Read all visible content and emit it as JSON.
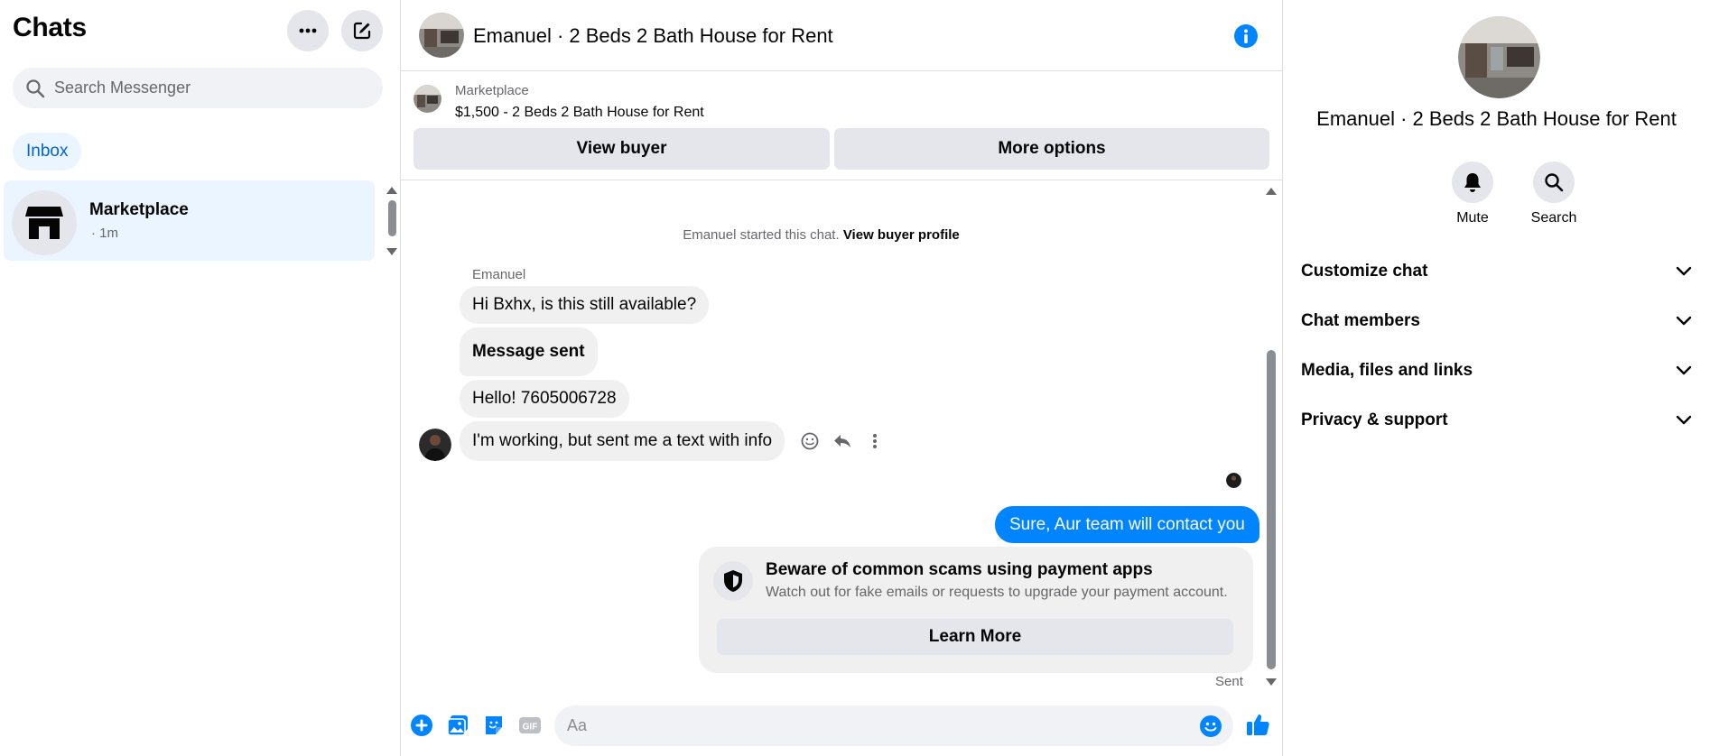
{
  "sidebar": {
    "title": "Chats",
    "search_placeholder": "Search Messenger",
    "filter_label": "Inbox",
    "conversation": {
      "name": "Marketplace",
      "time": "· 1m"
    }
  },
  "chat": {
    "header_title": "Emanuel · 2 Beds 2 Bath House for Rent",
    "listing": {
      "source": "Marketplace",
      "price_title": "$1,500 - 2 Beds 2 Bath House for Rent",
      "view_buyer_label": "View buyer",
      "more_options_label": "More options"
    },
    "started_text": "Emanuel started this chat.",
    "started_link": "View buyer profile",
    "sender_name": "Emanuel",
    "messages_in": [
      "Hi Bxhx, is this still available?",
      "Message sent",
      "Hello! 7605006728",
      "I'm working, but sent me a text with info"
    ],
    "message_out": "Sure, Aur team will contact you",
    "scam_notice": {
      "title": "Beware of common scams using payment apps",
      "description": "Watch out for fake emails or requests to upgrade your payment account.",
      "button_label": "Learn More"
    },
    "sent_status": "Sent",
    "composer_placeholder": "Aa"
  },
  "right_panel": {
    "title": "Emanuel · 2 Beds 2 Bath House for Rent",
    "actions": [
      {
        "label": "Mute",
        "icon": "bell-icon"
      },
      {
        "label": "Search",
        "icon": "search-icon"
      }
    ],
    "sections": [
      "Customize chat",
      "Chat members",
      "Media, files and links",
      "Privacy & support"
    ]
  },
  "colors": {
    "accent": "#0084ff",
    "inbox_pill_bg": "#ebf5ff",
    "inbox_pill_text": "#0064d1",
    "bubble_gray": "#f0f0f0",
    "button_gray": "#e4e6eb"
  }
}
